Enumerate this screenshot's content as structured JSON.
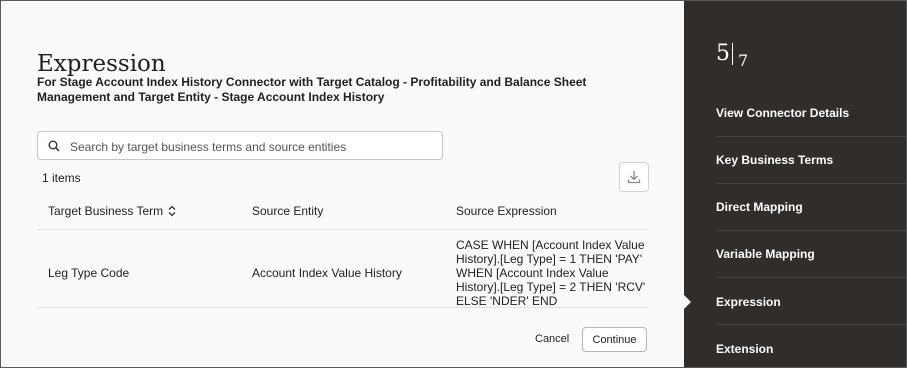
{
  "dialog": {
    "title": "Expression",
    "subtitle": "For Stage Account Index History Connector with Target Catalog - Profitability and Balance Sheet Management and Target Entity - Stage Account Index History"
  },
  "search": {
    "placeholder": "Search by target business terms and source entities",
    "value": ""
  },
  "table": {
    "count_label": "1 items",
    "columns": [
      "Target Business Term",
      "Source Entity",
      "Source Expression"
    ],
    "rows": [
      {
        "target_business_term": "Leg Type Code",
        "source_entity": "Account Index Value History",
        "source_expression_lines": [
          "CASE WHEN [Account Index Value",
          "History].[Leg Type] = 1 THEN 'PAY'",
          "WHEN [Account Index Value",
          "History].[Leg Type] = 2 THEN 'RCV'",
          "ELSE 'NDER' END"
        ]
      }
    ]
  },
  "footer": {
    "cancel_label": "Cancel",
    "continue_label": "Continue"
  },
  "sidebar": {
    "step_current": "5",
    "step_total": "7",
    "items": [
      {
        "label": "View Connector Details"
      },
      {
        "label": "Key Business Terms"
      },
      {
        "label": "Direct Mapping"
      },
      {
        "label": "Variable Mapping"
      },
      {
        "label": "Expression"
      },
      {
        "label": "Extension"
      }
    ],
    "active_index": 4
  },
  "colors": {
    "sidebar_bg": "#312d2a",
    "main_bg": "#fbfaf8",
    "text": "#1f1f1f"
  },
  "icons": {
    "search": "search-icon",
    "download": "download-icon",
    "sort": "sort-icon"
  }
}
